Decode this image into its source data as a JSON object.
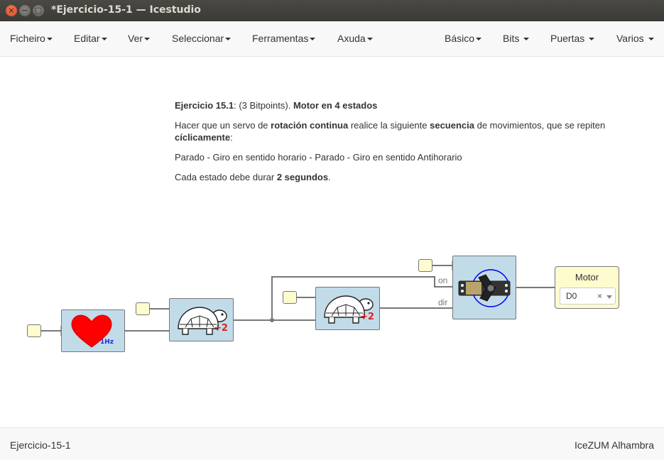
{
  "window": {
    "title": "*Ejercicio-15-1 — Icestudio",
    "close_glyph": "×",
    "min_glyph": "−",
    "max_glyph": "□"
  },
  "menu_left": [
    "Ficheiro",
    "Editar",
    "Ver",
    "Seleccionar",
    "Ferramentas",
    "Axuda"
  ],
  "menu_right": [
    "Básico",
    "Bits",
    "Puertas",
    "Varios"
  ],
  "info": {
    "line1": {
      "bold1": "Ejercicio 15.1",
      "mid": ": (3 Bitpoints). ",
      "bold2": "Motor en 4 estados"
    },
    "line2": {
      "t1": "Hacer que un servo de ",
      "b1": "rotación continua",
      "t2": " realice la siguiente ",
      "b2": "secuencia",
      "t3": " de movimientos, que se repiten ",
      "b3": "cíclicamente",
      "t4": ":"
    },
    "line3": "Parado - Giro en sentido horario - Parado - Giro en sentido Antihorario",
    "line4": {
      "t1": "Cada estado debe durar ",
      "b1": "2 segundos",
      "t2": "."
    }
  },
  "blocks": {
    "heart": {
      "freq_label": "1Hz"
    },
    "div1": {
      "label": "÷2"
    },
    "div2": {
      "label": "÷2"
    },
    "motor_wires": {
      "on": "on",
      "dir": "dir"
    },
    "output": {
      "name": "Motor",
      "pin": "D0",
      "clear_glyph": "×"
    }
  },
  "status": {
    "left": "Ejercicio-15-1",
    "right": "IceZUM Alhambra"
  },
  "colors": {
    "block_bg": "#c1dbe9",
    "port_bg": "#fefccf",
    "heart": "#ff0000",
    "div_text": "#dd2222",
    "freq_text": "#1a2fcf"
  }
}
